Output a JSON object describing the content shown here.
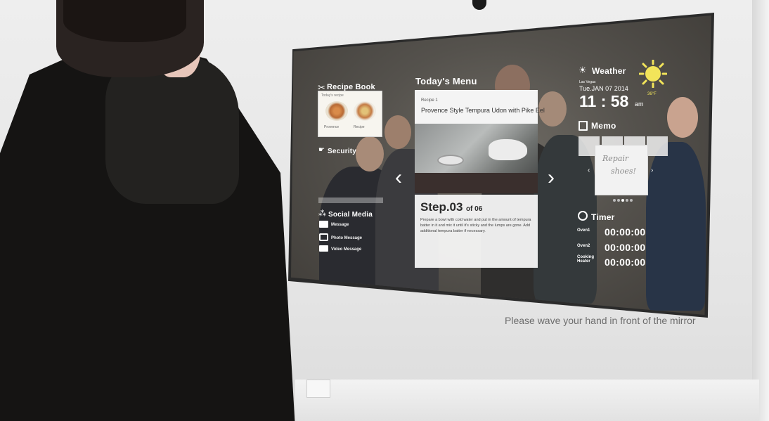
{
  "mirror_ui": {
    "recipe_book": {
      "title": "Recipe Book",
      "thumb_header": "Today's recipe",
      "thumb_captions": [
        "Provence",
        "Recipe"
      ]
    },
    "security": {
      "title": "Security"
    },
    "social_media": {
      "title": "Social Media",
      "items": [
        {
          "label": "Message"
        },
        {
          "label": "Photo Message"
        },
        {
          "label": "Video Message"
        }
      ]
    },
    "todays_menu": {
      "title": "Today's Menu",
      "recipe_number": "Recipe 1",
      "recipe_name": "Provence Style Tempura Udon with Pike Eel",
      "step_label": "Step.03",
      "step_of": "of 06",
      "step_text": "Prepare a bowl with cold water and put in the amount of tempura batter in it and mix it until it's sticky and the lumps are gone. Add additional tempura batter if necessary."
    },
    "weather": {
      "title": "Weather",
      "location": "Las Vegas",
      "date": "Tue.JAN 07 2014",
      "time": "11 : 58",
      "ampm": "am",
      "temperature": "36°F"
    },
    "memo": {
      "title": "Memo",
      "note_line1": "Repair",
      "note_line2": "shoes!"
    },
    "timer": {
      "title": "Timer",
      "rows": [
        {
          "label": "Oven1",
          "value": "00:00:00"
        },
        {
          "label": "Oven2",
          "value": "00:00:00"
        },
        {
          "label": "Cooking Heater",
          "value": "00:00:00"
        }
      ]
    }
  },
  "caption": "Please wave your hand in front of the mirror",
  "colors": {
    "ui_text": "#ffffff",
    "sun": "#f2e45a",
    "caption": "#6d6d6d"
  },
  "icons": [
    "recipe-book-icon",
    "security-icon",
    "social-media-icon",
    "message-icon",
    "photo-message-icon",
    "video-message-icon",
    "weather-icon",
    "sun-icon",
    "memo-icon",
    "timer-icon",
    "chevron-left-icon",
    "chevron-right-icon"
  ]
}
